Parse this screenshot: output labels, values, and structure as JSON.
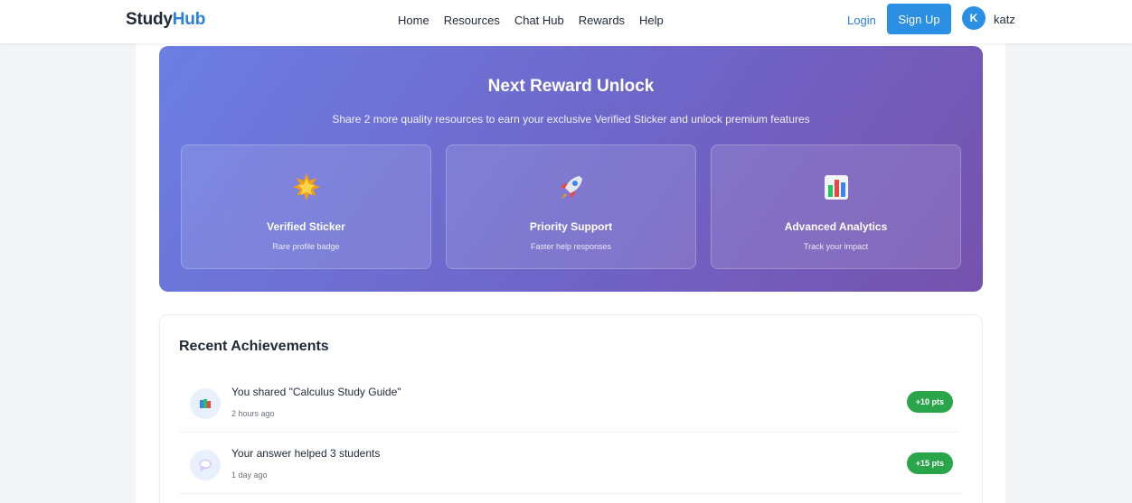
{
  "header": {
    "logo_part1": "Study",
    "logo_part2": "Hub",
    "nav": [
      "Home",
      "Resources",
      "Chat Hub",
      "Rewards",
      "Help"
    ],
    "login_label": "Login",
    "signup_label": "Sign Up",
    "avatar_initial": "K",
    "username": "katz"
  },
  "reward": {
    "title": "Next Reward Unlock",
    "subtitle": "Share 2 more quality resources to earn your exclusive Verified Sticker and unlock premium features",
    "cards": [
      {
        "icon": "star-sticker-icon",
        "name": "Verified Sticker",
        "desc": "Rare profile badge"
      },
      {
        "icon": "rocket-icon",
        "name": "Priority Support",
        "desc": "Faster help responses"
      },
      {
        "icon": "bar-chart-icon",
        "name": "Advanced Analytics",
        "desc": "Track your impact"
      }
    ]
  },
  "achievements": {
    "title": "Recent Achievements",
    "items": [
      {
        "icon": "books-icon",
        "text": "You shared \"Calculus Study Guide\"",
        "time": "2 hours ago",
        "points": "+10 pts"
      },
      {
        "icon": "speech-bubble-icon",
        "text": "Your answer helped 3 students",
        "time": "1 day ago",
        "points": "+15 pts"
      }
    ]
  },
  "colors": {
    "brand_blue": "#2b7fd6",
    "gradient_start": "#6b7ee2",
    "gradient_end": "#7652ae",
    "points_green": "#2aa54a"
  }
}
